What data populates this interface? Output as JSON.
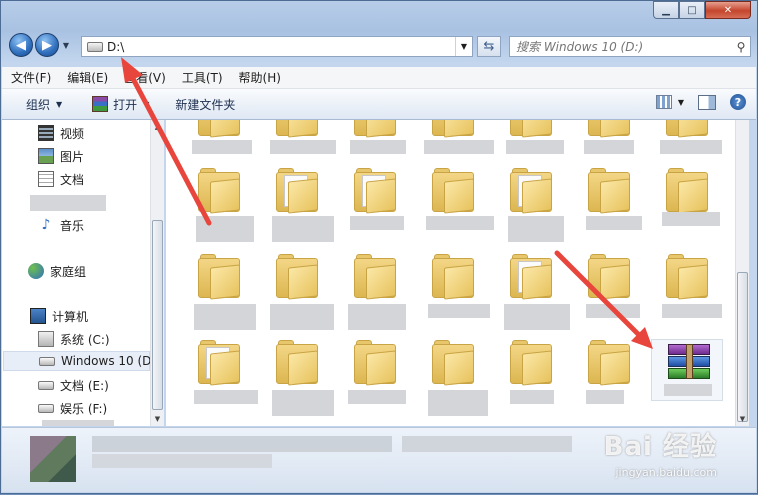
{
  "window": {
    "caption_min": "▁",
    "caption_max": "□",
    "caption_close": "✕"
  },
  "nav": {
    "back": "◀",
    "forward": "▶",
    "history_drop": "▼",
    "address": "D:\\",
    "address_drop": "▼",
    "refresh": "⇆",
    "search_placeholder": "搜索 Windows 10 (D:)"
  },
  "menu": {
    "items": [
      "文件(F)",
      "编辑(E)",
      "查看(V)",
      "工具(T)",
      "帮助(H)"
    ]
  },
  "toolbar": {
    "organize": "组织",
    "open": "打开",
    "new_folder": "新建文件夹",
    "help": "?"
  },
  "sidebar": {
    "items": [
      {
        "label": "视频",
        "icon": "video-icon"
      },
      {
        "label": "图片",
        "icon": "picture-icon"
      },
      {
        "label": "文档",
        "icon": "document-icon"
      },
      {
        "label": "音乐",
        "icon": "music-icon"
      },
      {
        "label": "家庭组",
        "icon": "homegroup-icon"
      },
      {
        "label": "计算机",
        "icon": "computer-icon"
      },
      {
        "label": "系统 (C:)",
        "icon": "system-drive-icon"
      },
      {
        "label": "Windows 10 (D",
        "icon": "drive-icon"
      },
      {
        "label": "文档 (E:)",
        "icon": "drive-icon"
      },
      {
        "label": "娱乐 (F:)",
        "icon": "drive-icon"
      }
    ]
  },
  "watermark": {
    "brand": "Bai 经验",
    "url": "jingyan.baidu.com"
  },
  "colors": {
    "arrow": "#e8453c",
    "folder": "#e7c35e",
    "selection": "#e8eef7"
  }
}
